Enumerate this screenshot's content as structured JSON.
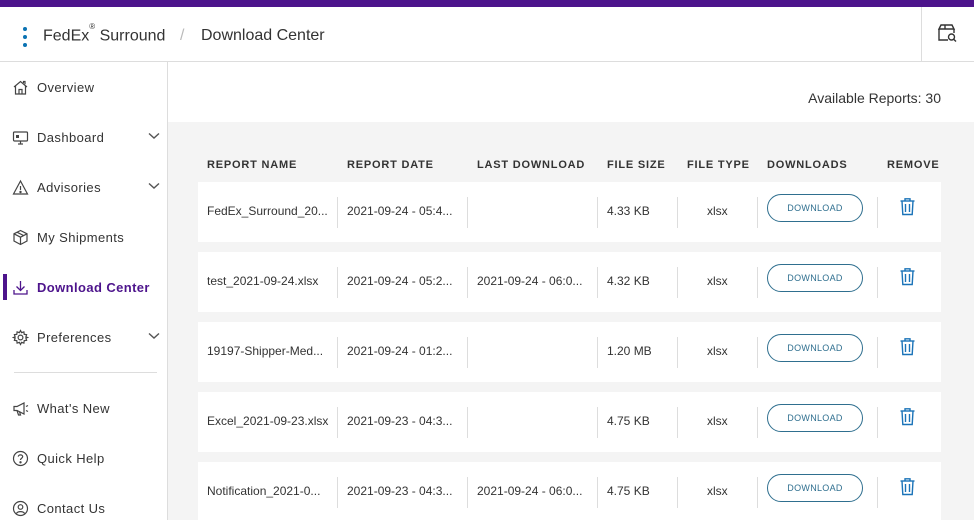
{
  "header": {
    "brand_name": "FedEx",
    "brand_reg": "®",
    "brand_product": " Surround",
    "breadcrumb_sep": "/",
    "breadcrumb_current": "Download Center",
    "action_icon": "box-search-icon"
  },
  "sidebar": {
    "items": [
      {
        "label": "Overview",
        "icon": "home-icon"
      },
      {
        "label": "Dashboard",
        "icon": "monitor-icon",
        "expandable": true
      },
      {
        "label": "Advisories",
        "icon": "warning-icon",
        "expandable": true
      },
      {
        "label": "My Shipments",
        "icon": "package-icon"
      },
      {
        "label": "Download Center",
        "icon": "download-icon",
        "active": true
      },
      {
        "label": "Preferences",
        "icon": "gear-icon",
        "expandable": true
      },
      {
        "label": "What's New",
        "icon": "megaphone-icon"
      },
      {
        "label": "Quick Help",
        "icon": "help-icon"
      },
      {
        "label": "Contact Us",
        "icon": "contact-icon"
      }
    ]
  },
  "main": {
    "available_reports": "Available Reports: 30",
    "columns": [
      "Report Name",
      "Report Date",
      "Last Download",
      "File Size",
      "File Type",
      "Downloads",
      "Remove"
    ],
    "download_label": "DOWNLOAD",
    "rows": [
      {
        "name": "FedEx_Surround_20...",
        "date": "2021-09-24 - 05:4...",
        "last_download": "",
        "size": "4.33 KB",
        "type": "xlsx"
      },
      {
        "name": "test_2021-09-24.xlsx",
        "date": "2021-09-24 - 05:2...",
        "last_download": "2021-09-24 - 06:0...",
        "size": "4.32 KB",
        "type": "xlsx"
      },
      {
        "name": "19197-Shipper-Med...",
        "date": "2021-09-24 - 01:2...",
        "last_download": "",
        "size": "1.20 MB",
        "type": "xlsx"
      },
      {
        "name": "Excel_2021-09-23.xlsx",
        "date": "2021-09-23 - 04:3...",
        "last_download": "",
        "size": "4.75 KB",
        "type": "xlsx"
      },
      {
        "name": "Notification_2021-0...",
        "date": "2021-09-23 - 04:3...",
        "last_download": "2021-09-24 - 06:0...",
        "size": "4.75 KB",
        "type": "xlsx"
      }
    ]
  },
  "colors": {
    "brand_purple": "#4d148c",
    "link_blue": "#0a73b3",
    "button_teal": "#2f6f8f"
  }
}
